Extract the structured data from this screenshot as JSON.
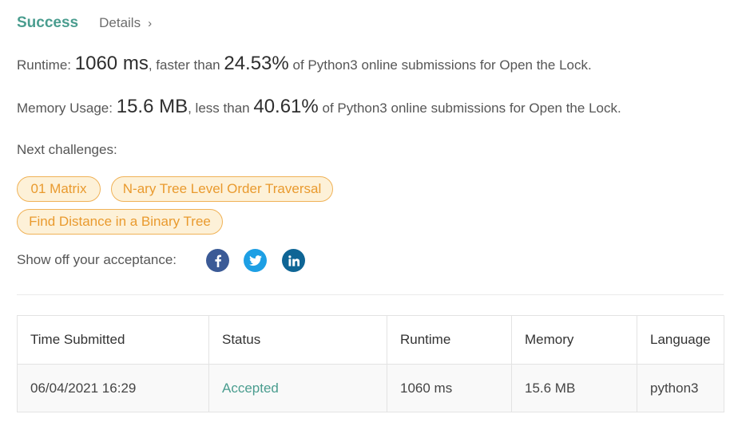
{
  "header": {
    "status": "Success",
    "details_label": "Details",
    "chevron": "›"
  },
  "runtime_line": {
    "label": "Runtime:",
    "value": "1060 ms",
    "mid_text": ", faster than",
    "percent": "24.53%",
    "suffix": "of Python3 online submissions for Open the Lock."
  },
  "memory_line": {
    "label": "Memory Usage:",
    "value": "15.6 MB",
    "mid_text": ", less than",
    "percent": "40.61%",
    "suffix": "of Python3 online submissions for Open the Lock."
  },
  "next_challenges": {
    "label": "Next challenges:",
    "items": [
      "01 Matrix",
      "N-ary Tree Level Order Traversal",
      "Find Distance in a Binary Tree"
    ]
  },
  "share": {
    "label": "Show off your acceptance:",
    "icons": [
      "facebook-icon",
      "twitter-icon",
      "linkedin-icon"
    ]
  },
  "table": {
    "columns": [
      "Time Submitted",
      "Status",
      "Runtime",
      "Memory",
      "Language"
    ],
    "rows": [
      {
        "time": "06/04/2021 16:29",
        "status": "Accepted",
        "runtime": "1060 ms",
        "memory": "15.6 MB",
        "language": "python3"
      }
    ]
  },
  "colors": {
    "success": "#4a9d8f",
    "chip_border": "#f0b257",
    "chip_bg": "#fdf1d8",
    "chip_text": "#e99a2e",
    "facebook": "#3b5a96",
    "twitter": "#1d9fe4",
    "linkedin": "#0e6595"
  }
}
